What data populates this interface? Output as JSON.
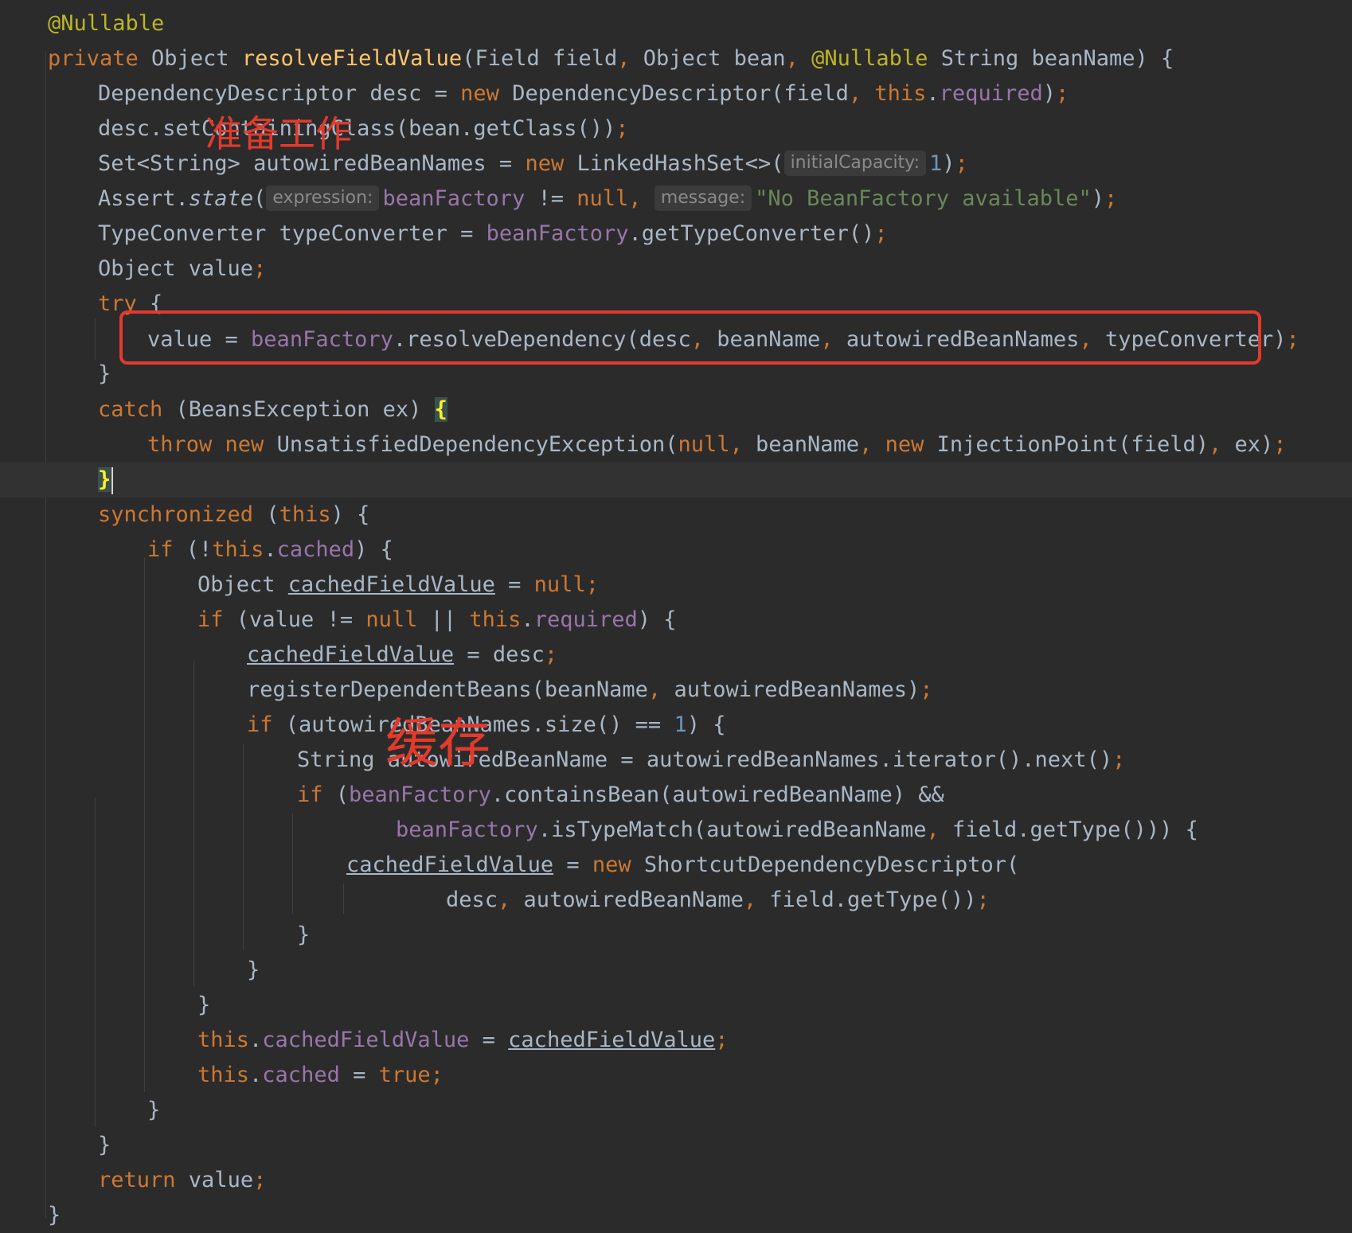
{
  "editor": {
    "hint_initial_capacity": "initialCapacity:",
    "hint_expression": "expression:",
    "hint_message": "message:",
    "string_no_factory": "\"No BeanFactory available\"",
    "annotation_prepare": "准备工作",
    "annotation_cache": "缓存"
  },
  "colors": {
    "background": "#2b2b2b",
    "keyword": "#cc7832",
    "annotation": "#bbb529",
    "method_decl": "#ffc66d",
    "field": "#9876aa",
    "string": "#6a8759",
    "number": "#6897bb",
    "default_text": "#a9b7c6",
    "highlight_box": "#e33a2c"
  }
}
